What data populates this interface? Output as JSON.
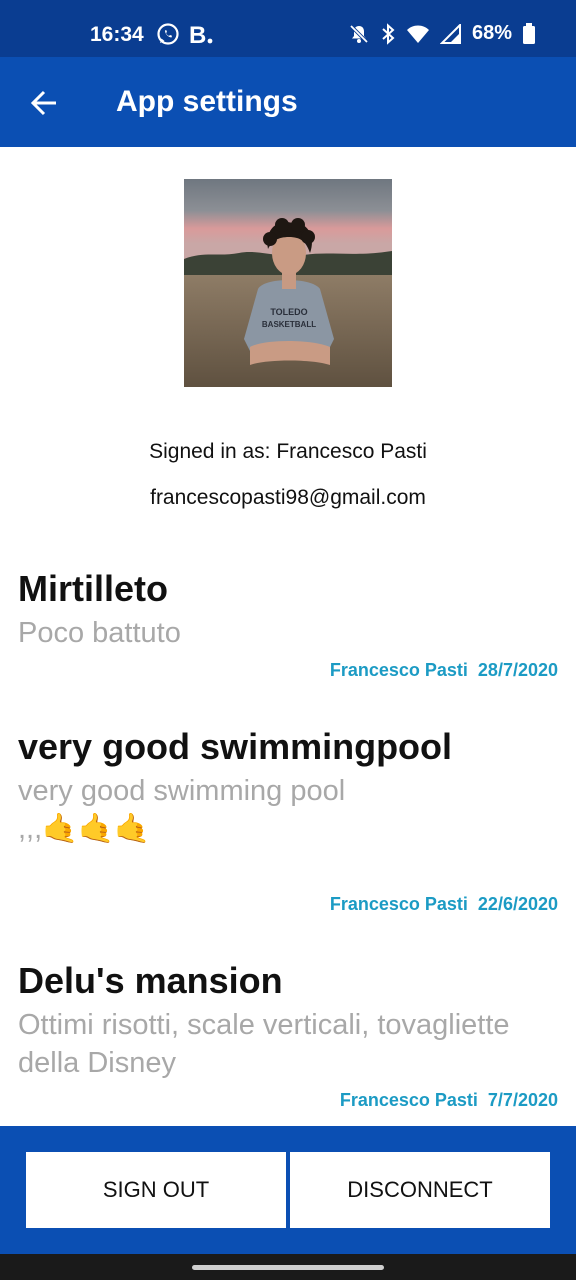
{
  "status_bar": {
    "time": "16:34",
    "battery_percent": "68%",
    "left_icons": [
      "whatsapp-icon",
      "bold-b-icon"
    ],
    "right_icons": [
      "mute-bell-icon",
      "bluetooth-icon",
      "wifi-icon",
      "signal-icon",
      "battery-icon"
    ]
  },
  "app_bar": {
    "title": "App settings",
    "back_icon": "back-arrow-icon",
    "color": "#0b4fb3"
  },
  "profile": {
    "signed_in_label": "Signed in as: Francesco Pasti",
    "email": "francescopasti98@gmail.com",
    "shirt_text_line1": "TOLEDO",
    "shirt_text_line2": "BASKETBALL"
  },
  "reviews": [
    {
      "title": "Mirtilleto",
      "body": "Poco battuto",
      "author": "Francesco Pasti",
      "date": "28/7/2020"
    },
    {
      "title": "very good swimmingpool",
      "body": "very good swimming pool",
      "body_line2": ",,,🤙🤙🤙",
      "author": "Francesco Pasti",
      "date": "22/6/2020"
    },
    {
      "title": "Delu's mansion",
      "body": "Ottimi risotti, scale verticali, tovagliette della Disney",
      "author": "Francesco Pasti",
      "date": "7/7/2020"
    }
  ],
  "actions": {
    "sign_out_label": "SIGN OUT",
    "disconnect_label": "DISCONNECT"
  },
  "colors": {
    "status_bar": "#0a3d91",
    "accent": "#0b4fb3",
    "meta_text": "#1c9bc4",
    "body_text": "#a8a8a8"
  }
}
